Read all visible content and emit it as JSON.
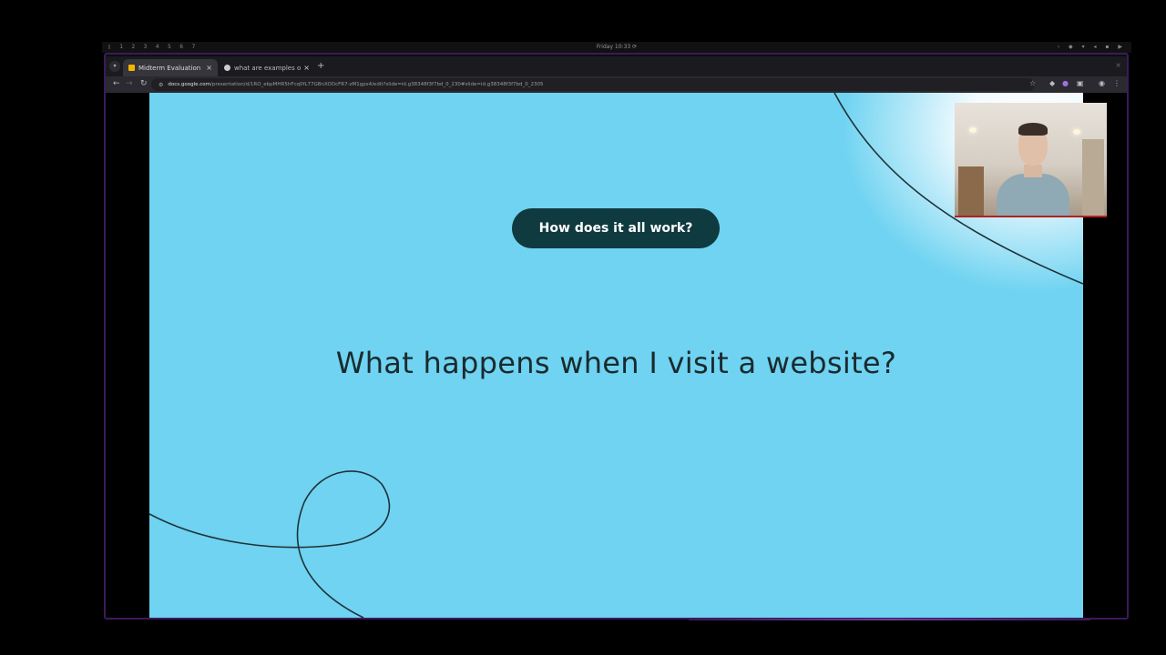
{
  "system_bar": {
    "workspaces": "▯ 1 2 3 4 5 6 7",
    "clock": "Friday 10:33 ⟳"
  },
  "browser": {
    "tabs": [
      {
        "title": "Midterm Evaluation - G",
        "favicon": "slides-icon",
        "active": true
      },
      {
        "title": "what are examples of ...",
        "favicon": "globe-icon",
        "active": false
      }
    ],
    "url_domain": "docs.google.com",
    "url_path": "/presentation/d/1RO_ebpMHR5hFcq0fL77GBnXOOcFR7-zM1gps4/edit?slide=id.g38348f3f7bd_0_230#slide=id.g38348f3f7bd_0_2305"
  },
  "slide": {
    "pill_text": "How does it all work?",
    "headline": "What happens when I visit a website?"
  },
  "colors": {
    "slide_background": "#6fd3f1",
    "pill_background": "#0f3a3f",
    "window_border": "#3a1b5a"
  }
}
